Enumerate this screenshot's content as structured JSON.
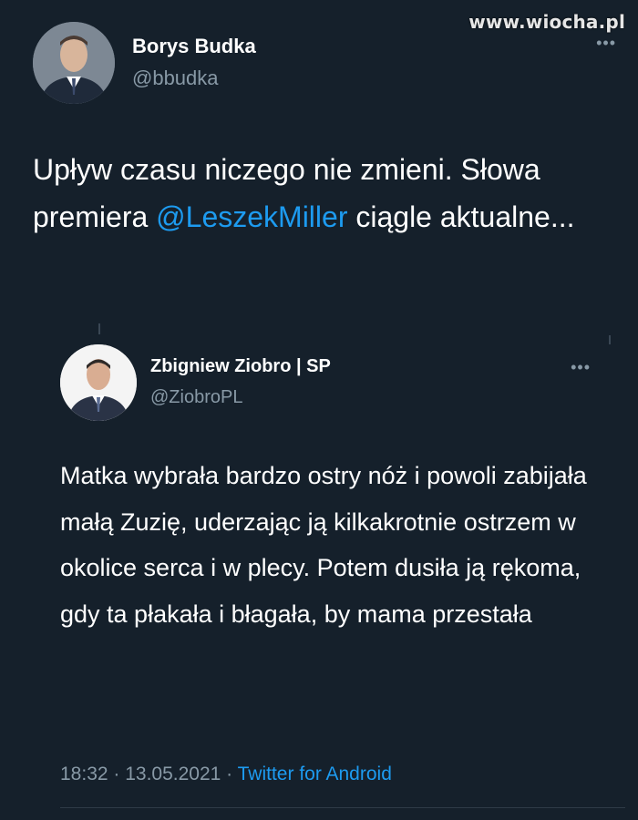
{
  "watermark": "www.wiocha.pl",
  "more_icon": "more-dots-icon",
  "main_tweet": {
    "author_name": "Borys Budka",
    "author_handle": "@bbudka",
    "text_before_mention": "Upływ czasu niczego nie zmieni. Słowa premiera ",
    "mention": "@LeszekMiller",
    "text_after_mention": " ciągle aktualne...",
    "avatar_icon": "avatar-borys-budka"
  },
  "quoted_tweet": {
    "author_name": "Zbigniew Ziobro | SP",
    "author_handle": "@ZiobroPL",
    "text": "Matka wybrała bardzo ostry nóż i powoli zabijała małą Zuzię, uderzając ją kilkakrotnie ostrzem w okolice serca i w plecy. Potem dusiła ją rękoma, gdy ta płakała i błagała, by mama przestała",
    "avatar_icon": "avatar-zbigniew-ziobro"
  },
  "meta": {
    "time": "18:32",
    "separator": " · ",
    "date": "13.05.2021",
    "source": "Twitter for Android"
  },
  "colors": {
    "background": "#15202b",
    "text_primary": "#ffffff",
    "text_secondary": "#8899a6",
    "accent": "#1d9bf0"
  }
}
